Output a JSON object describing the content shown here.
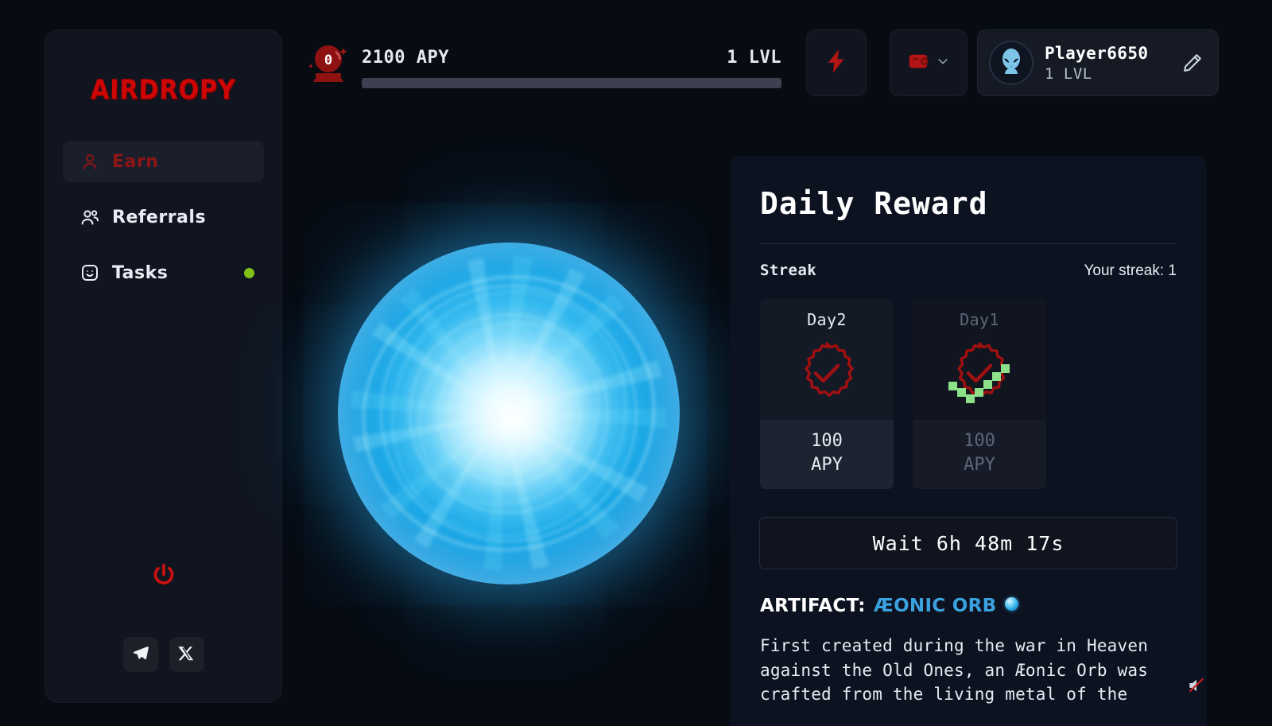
{
  "app": {
    "logo_text": "AIRDROPY"
  },
  "sidebar": {
    "items": [
      {
        "label": "Earn",
        "icon": "user-icon",
        "active": true,
        "dot": false
      },
      {
        "label": "Referrals",
        "icon": "users-icon",
        "active": false,
        "dot": false
      },
      {
        "label": "Tasks",
        "icon": "smiley-icon",
        "active": false,
        "dot": true
      }
    ],
    "logout_icon": "power-icon",
    "socials": [
      {
        "name": "telegram-icon"
      },
      {
        "name": "x-icon"
      }
    ]
  },
  "topbar": {
    "orb_count": "0",
    "apy_text": "2100 APY",
    "lvl_text": "1 LVL",
    "progress_percent": 0,
    "bolt_icon": "lightning-bolt-icon",
    "wallet_icon": "wallet-icon",
    "wallet_chevron": "chevron-down-icon",
    "profile": {
      "name": "Player6650",
      "level": "1 LVL",
      "avatar_icon": "alien-avatar-icon",
      "edit_icon": "pencil-icon"
    }
  },
  "stage": {
    "orb_name": "energy-orb"
  },
  "panel": {
    "title": "Daily Reward",
    "streak_label": "Streak",
    "streak_value": "Your streak: 1",
    "days": [
      {
        "name": "Day2",
        "amount": "100",
        "unit": "APY",
        "claimed": false,
        "state": "active"
      },
      {
        "name": "Day1",
        "amount": "100",
        "unit": "APY",
        "claimed": true,
        "state": "dim"
      }
    ],
    "wait_button": "Wait 6h 48m 17s",
    "artifact_label": "ARTIFACT:",
    "artifact_name": "ÆONIC ORB",
    "artifact_desc": "First created during the war in Heaven\nagainst the Old Ones, an Æonic Orb was\ncrafted from the living metal of the"
  },
  "footer": {
    "mute_icon": "speaker-muted-icon"
  },
  "colors": {
    "brand_red": "#c01a1a",
    "accent_blue": "#3ba2e0",
    "dot_green": "#82c117",
    "panel_bg": "#0d1220",
    "page_bg": "#070b12"
  }
}
